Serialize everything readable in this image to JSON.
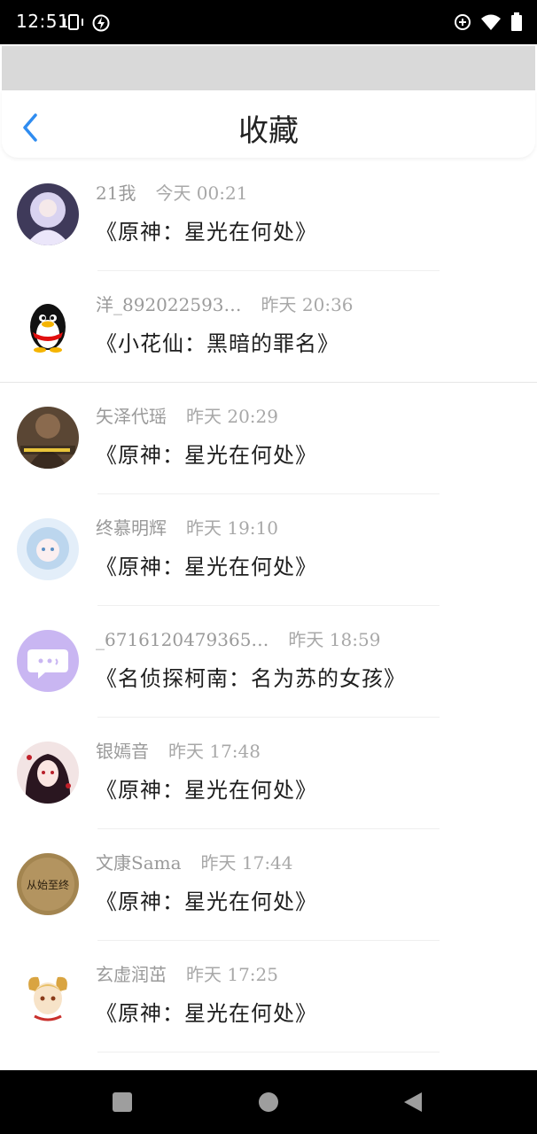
{
  "status_bar": {
    "time": "12:51",
    "icons": [
      "vibrate-icon",
      "flash-icon",
      "data-saver-icon",
      "wifi-icon",
      "battery-icon"
    ]
  },
  "header": {
    "title": "收藏",
    "back_icon": "chevron-left-icon",
    "accent": "#2f8cf0"
  },
  "favorites": [
    {
      "user": "21我",
      "time": "今天 00:21",
      "title": "《原神：星光在何处》",
      "avatar_color": "#c9c3e6"
    },
    {
      "user": "洋_892022593…",
      "time": "昨天 20:36",
      "title": "《小花仙：黑暗的罪名》",
      "avatar_color": "#ffffff"
    },
    {
      "user": "矢泽代瑶",
      "time": "昨天 20:29",
      "title": "《原神：星光在何处》",
      "avatar_color": "#6b5642"
    },
    {
      "user": "终慕明辉",
      "time": "昨天 19:10",
      "title": "《原神：星光在何处》",
      "avatar_color": "#cfe2f3"
    },
    {
      "user": "_6716120479365…",
      "time": "昨天 18:59",
      "title": "《名侦探柯南：名为苏的女孩》",
      "avatar_color": "#c9b6f2"
    },
    {
      "user": "银嫣音",
      "time": "昨天 17:48",
      "title": "《原神：星光在何处》",
      "avatar_color": "#3a1f2a"
    },
    {
      "user": "文康Sama",
      "time": "昨天 17:44",
      "title": "《原神：星光在何处》",
      "avatar_color": "#9b7a45",
      "avatar_text": "从始至终"
    },
    {
      "user": "玄虚润茁",
      "time": "昨天 17:25",
      "title": "《原神：星光在何处》",
      "avatar_color": "#f4e4c0"
    }
  ],
  "nav_bar": {
    "icons": [
      "recents-square-icon",
      "home-circle-icon",
      "back-triangle-icon"
    ]
  }
}
